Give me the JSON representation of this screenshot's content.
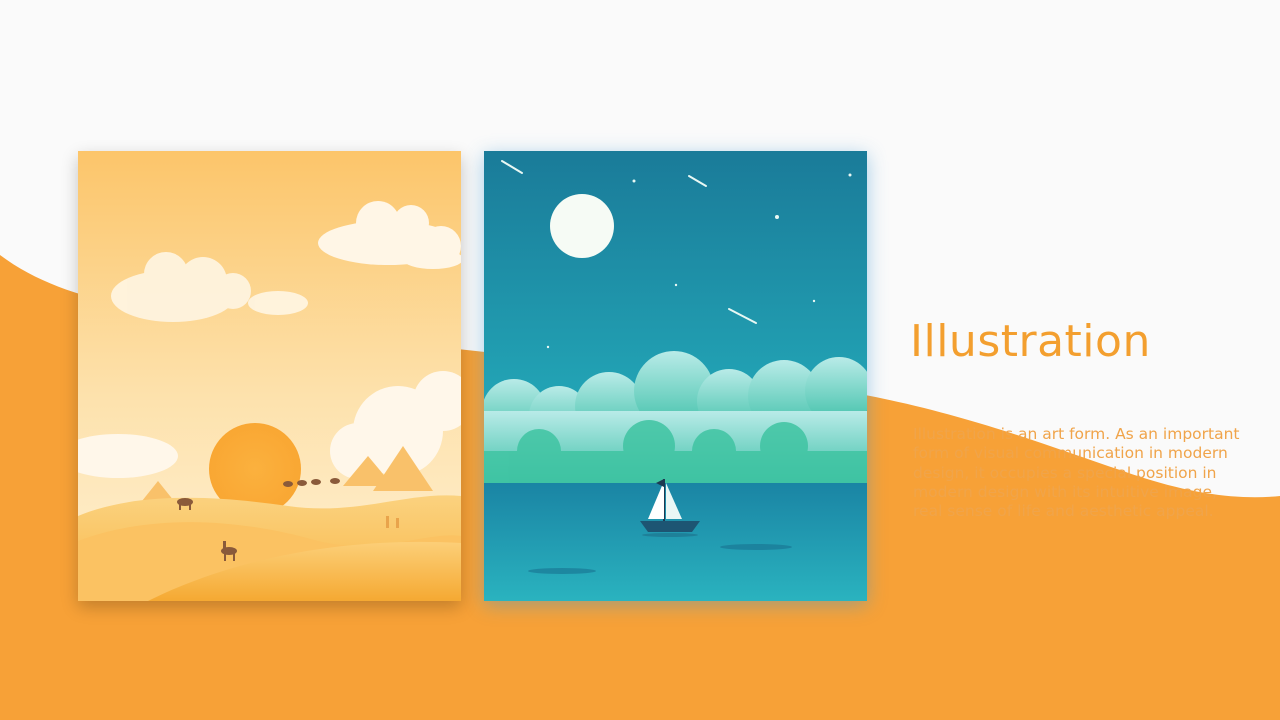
{
  "slide": {
    "title": "Illustration",
    "body": "Illustration is an art form. As an important form of visual communication in modern design, it occupies a special position in modern design with its intuitive image, real sense of life and aesthetic appeal."
  },
  "colors": {
    "accent": "#f7a137",
    "background": "#fafafa",
    "title": "#f39f2f"
  }
}
